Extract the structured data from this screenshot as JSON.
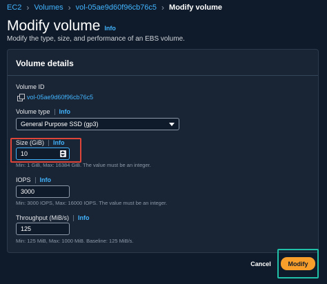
{
  "breadcrumb": {
    "items": [
      "EC2",
      "Volumes",
      "vol-05ae9d60f96cb76c5"
    ],
    "current": "Modify volume"
  },
  "header": {
    "title": "Modify volume",
    "info": "Info",
    "subtitle": "Modify the type, size, and performance of an EBS volume."
  },
  "panel": {
    "title": "Volume details",
    "volume_id": {
      "label": "Volume ID",
      "value": "vol-05ae9d60f96cb76c5"
    },
    "volume_type": {
      "label": "Volume type",
      "info": "Info",
      "value": "General Purpose SSD (gp3)"
    },
    "size": {
      "label": "Size (GiB)",
      "info": "Info",
      "value": "10",
      "hint": "Min: 1 GiB, Max: 16384 GiB. The value must be an integer."
    },
    "iops": {
      "label": "IOPS",
      "info": "Info",
      "value": "3000",
      "hint": "Min: 3000 IOPS, Max: 16000 IOPS. The value must be an integer."
    },
    "throughput": {
      "label": "Throughput (MiB/s)",
      "info": "Info",
      "value": "125",
      "hint": "Min: 125 MiB, Max: 1000 MiB. Baseline: 125 MiB/s."
    }
  },
  "actions": {
    "cancel": "Cancel",
    "modify": "Modify"
  },
  "colors": {
    "background": "#0f1b2a",
    "panel": "#192534",
    "link": "#42b4ff",
    "primary_button": "#f89e2b",
    "highlight_red": "#e0453a",
    "highlight_teal": "#1fbfa8"
  }
}
